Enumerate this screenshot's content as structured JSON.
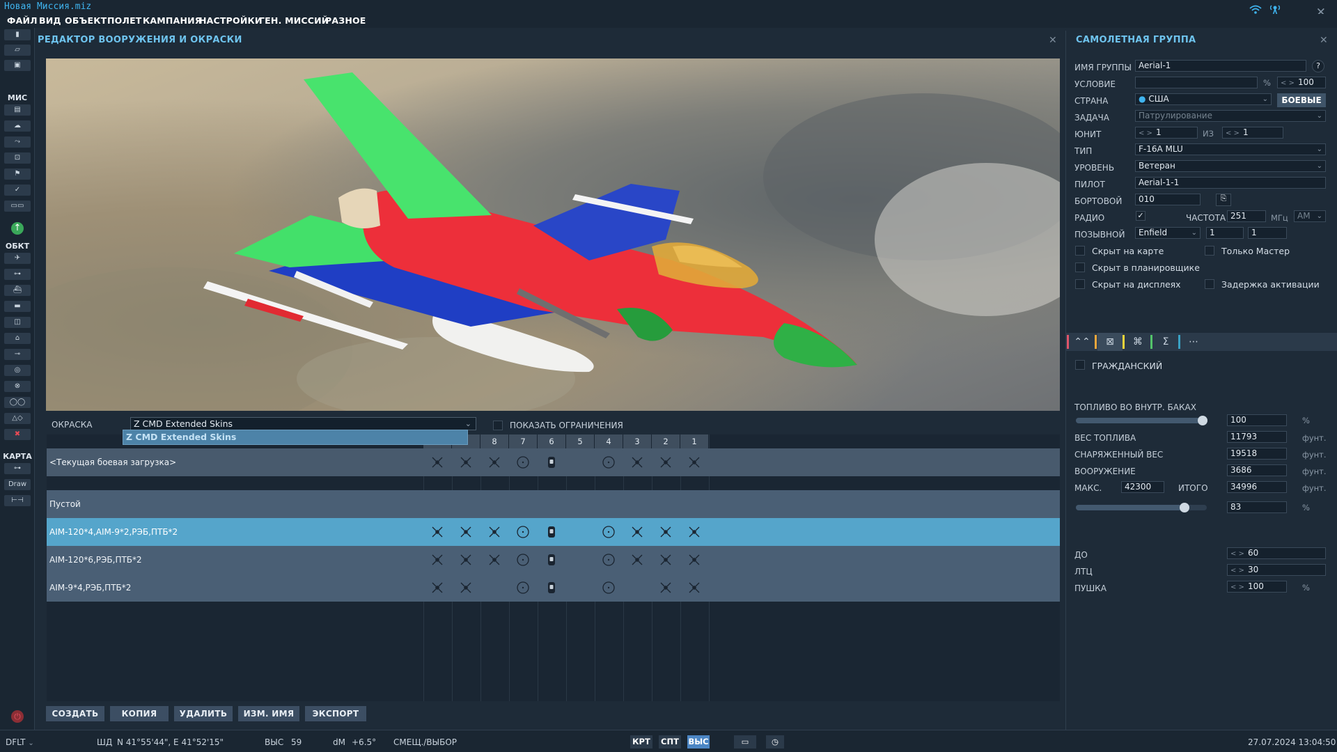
{
  "window": {
    "title": "Новая Миссия.miz"
  },
  "menu": [
    "ФАЙЛ",
    "ВИД",
    "ОБЪЕКТ",
    "ПОЛЕТ",
    "КАМПАНИЯ",
    "НАСТРОЙКИ",
    "ГЕН. МИССИЙ",
    "РАЗНОЕ"
  ],
  "left_toolbar": {
    "section_mission": "МИС",
    "section_objects": "ОБКТ",
    "section_map": "КАРТА",
    "draw_label": "Draw"
  },
  "editor": {
    "title": "РЕДАКТОР ВООРУЖЕНИЯ И ОКРАСКИ",
    "skin_label": "ОКРАСКА",
    "skin_value": "Z CMD Extended Skins",
    "skin_options": [
      "Z CMD Extended Skins"
    ],
    "show_limits_label": "ПОКАЗАТЬ ОГРАНИЧЕНИЯ",
    "pylon_headers": [
      "",
      "",
      "8",
      "7",
      "6",
      "5",
      "4",
      "3",
      "2",
      "1"
    ],
    "current_loadout": "<Текущая боевая загрузка>",
    "loadouts": [
      {
        "name": "Пустой",
        "icons": [
          "",
          "",
          "",
          "",
          "",
          "",
          "",
          "",
          "",
          ""
        ]
      },
      {
        "name": "AIM-120*4,AIM-9*2,РЭБ,ПТБ*2",
        "icons": [
          "x",
          "x",
          "x",
          "o",
          "pod",
          "",
          "o",
          "x",
          "x",
          "x"
        ]
      },
      {
        "name": "AIM-120*6,РЭБ,ПТБ*2",
        "icons": [
          "x",
          "x",
          "x",
          "o",
          "pod",
          "",
          "o",
          "x",
          "x",
          "x"
        ]
      },
      {
        "name": "AIM-9*4,РЭБ,ПТБ*2",
        "icons": [
          "x",
          "x",
          "",
          "o",
          "pod",
          "",
          "o",
          "",
          "x",
          "x"
        ]
      }
    ],
    "current_icons": [
      "x",
      "x",
      "x",
      "o",
      "pod",
      "",
      "o",
      "x",
      "x",
      "x"
    ],
    "selected_index": 1,
    "buttons": [
      "СОЗДАТЬ",
      "КОПИЯ",
      "УДАЛИТЬ",
      "ИЗМ. ИМЯ",
      "ЭКСПОРТ"
    ]
  },
  "group": {
    "title": "САМОЛЕТНАЯ ГРУППА",
    "name_label": "ИМЯ ГРУППЫ",
    "name": "Aerial-1",
    "condition_label": "УСЛОВИЕ",
    "condition": "",
    "condition_percent": "100",
    "country_label": "СТРАНА",
    "country": "США",
    "combat_button": "БОЕВЫЕ",
    "task_label": "ЗАДАЧА",
    "task": "Патрулирование",
    "unit_label": "ЮНИТ",
    "unit": "1",
    "of_label": "ИЗ",
    "unit_total": "1",
    "type_label": "ТИП",
    "type": "F-16A MLU",
    "skill_label": "УРОВЕНЬ",
    "skill": "Ветеран",
    "pilot_label": "ПИЛОТ",
    "pilot": "Aerial-1-1",
    "tail_label": "БОРТОВОЙ",
    "tail": "010",
    "radio_label": "РАДИО",
    "radio_checked": true,
    "freq_label": "ЧАСТОТА",
    "freq": "251",
    "freq_unit": "МГц",
    "modulation": "AM",
    "callsign_label": "ПОЗЫВНОЙ",
    "callsign": "Enfield",
    "callsign_num1": "1",
    "callsign_num2": "1",
    "hidden_map": "Скрыт на карте",
    "master_only": "Только Мастер",
    "hidden_planner": "Скрыт в планировщике",
    "hidden_display": "Скрыт на дисплеях",
    "late_activation": "Задержка активации"
  },
  "payload": {
    "civil_label": "ГРАЖДАНСКИЙ",
    "fuel_label": "ТОПЛИВО ВО ВНУТР. БАКАХ",
    "fuel_percent": "100",
    "fuel_fraction": 1.0,
    "fuel_weight_label": "ВЕС ТОПЛИВА",
    "fuel_weight": "11793",
    "empty_weight_label": "СНАРЯЖЕННЫЙ ВЕС",
    "empty_weight": "19518",
    "weapons_label": "ВООРУЖЕНИЕ",
    "weapons_weight": "3686",
    "max_label": "МАКС.",
    "max_weight": "42300",
    "total_label": "ИТОГО",
    "total_weight": "34996",
    "load_percent": "83",
    "load_fraction": 0.83,
    "unit": "фунт.",
    "pct": "%",
    "chaff_label": "ДО",
    "chaff": "60",
    "flare_label": "ЛТЦ",
    "flare": "30",
    "gun_label": "ПУШКА",
    "gun": "100"
  },
  "status": {
    "profile": "DFLT",
    "coord_label": "ШД",
    "coords": "N 41°55'44\", E 41°52'15\"",
    "alt_label": "ВЫС",
    "alt": "59",
    "dm_label": "dM",
    "dm": "+6.5°",
    "mode": "СМЕЩ./ВЫБОР",
    "btn_map": "КРТ",
    "btn_sat": "СПТ",
    "btn_alt": "ВЫС",
    "datetime": "27.07.2024 13:04:50"
  },
  "colors": {
    "accent": "#3fb4ef",
    "selected_row": "#55a5cb",
    "tab_colors": [
      "#e0556a",
      "#f0a73c",
      "#f2d43a",
      "#53c36a",
      "#3aa2c4"
    ]
  }
}
